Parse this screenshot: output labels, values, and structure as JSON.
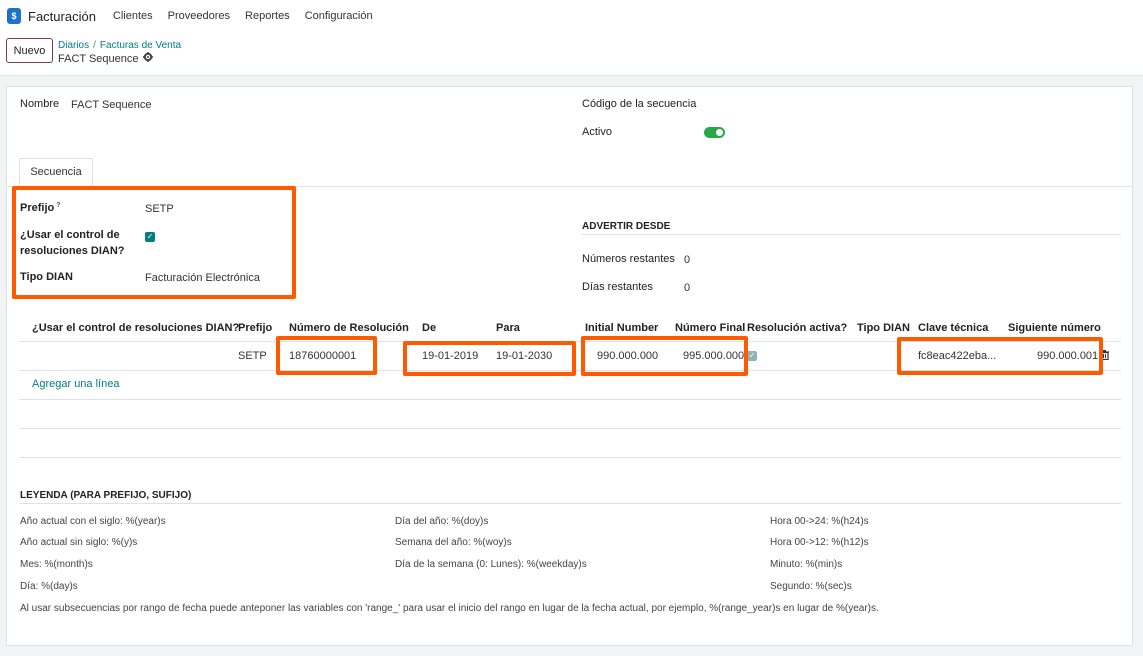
{
  "navbar": {
    "app_name": "Facturación",
    "menu": [
      "Clientes",
      "Proveedores",
      "Reportes",
      "Configuración"
    ]
  },
  "control_panel": {
    "new_button": "Nuevo",
    "breadcrumb": [
      "Diarios",
      "Facturas de Venta"
    ],
    "record_title": "FACT Sequence"
  },
  "form": {
    "name_label": "Nombre",
    "name_value": "FACT Sequence",
    "code_label": "Código de la secuencia",
    "active_label": "Activo",
    "active_value": true,
    "tab_label": "Secuencia",
    "prefix_label": "Prefijo",
    "prefix_help": "?",
    "prefix_value": "SETP",
    "use_dian_label_line1": "¿Usar el control de",
    "use_dian_label_line2": "resoluciones DIAN?",
    "use_dian_value": true,
    "dian_type_label": "Tipo DIAN",
    "dian_type_value": "Facturación Electrónica",
    "warn_section_title": "ADVERTIR DESDE",
    "remaining_numbers_label": "Números restantes",
    "remaining_numbers_value": "0",
    "remaining_days_label": "Días restantes",
    "remaining_days_value": "0"
  },
  "table": {
    "headers": {
      "use_dian": "¿Usar el control de resoluciones DIAN?",
      "prefix": "Prefijo",
      "resolution_number": "Número de Resolución",
      "from": "De",
      "to": "Para",
      "initial_number": "Initial Number",
      "final_number": "Número Final",
      "active_resolution": "Resolución activa?",
      "dian_type": "Tipo DIAN",
      "technical_key": "Clave técnica",
      "next_number": "Siguiente número"
    },
    "row": {
      "prefix": "SETP",
      "resolution_number": "18760000001",
      "from": "19-01-2019",
      "to": "19-01-2030",
      "initial_number": "990.000.000",
      "final_number": "995.000.000",
      "active_resolution": true,
      "technical_key": "fc8eac422eba...",
      "next_number": "990.000.001"
    },
    "add_line": "Agregar una línea"
  },
  "legend": {
    "title": "LEYENDA (PARA PREFIJO, SUFIJO)",
    "col1": [
      "Año actual con el siglo: %(year)s",
      "Año actual sin siglo: %(y)s",
      "Mes: %(month)s",
      "Día: %(day)s"
    ],
    "col2": [
      "Día del año: %(doy)s",
      "Semana del año: %(woy)s",
      "Día de la semana (0: Lunes): %(weekday)s"
    ],
    "col3": [
      "Hora 00->24: %(h24)s",
      "Hora 00->12: %(h12)s",
      "Minuto: %(min)s",
      "Segundo: %(sec)s"
    ],
    "note": "Al usar subsecuencias por rango de fecha puede anteponer las variables con 'range_' para usar el inicio del rango en lugar de la fecha actual, por ejemplo, %(range_year)s en lugar de %(year)s."
  },
  "colors": {
    "highlight": "#ff5a00",
    "accent": "#017e84",
    "toggle_on": "#28a745",
    "brand": "#71404f"
  },
  "icons": {
    "app_logo": "invoice-app-icon",
    "gear": "gear-icon",
    "trash": "trash-icon",
    "check": "check-icon"
  }
}
